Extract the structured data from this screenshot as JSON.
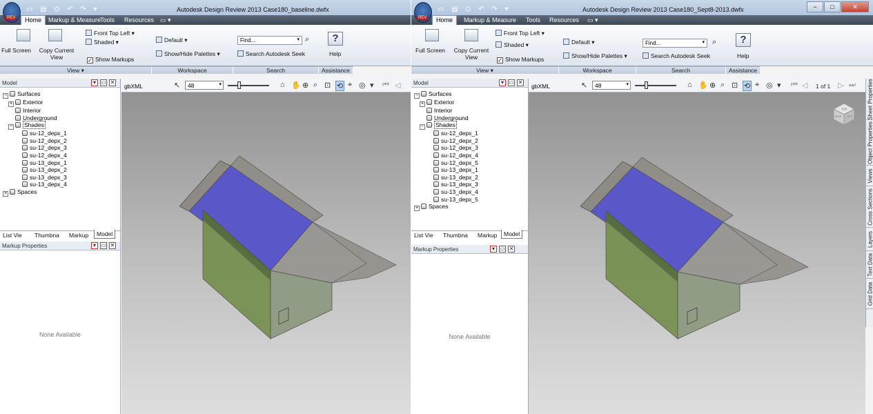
{
  "colors": {
    "ribbon_dark": "#4a5566",
    "canvas_top": "#929292",
    "canvas_bottom": "#dedede",
    "roof_blue": "#5050c8",
    "wall_green": "#789848"
  },
  "windows": [
    {
      "title": "Autodesk Design Review 2013    Case180_baseline.dwfx",
      "app_badge": "REV",
      "ribbon_tabs": [
        "Home",
        "Markup & Measure",
        "Tools",
        "Resources"
      ],
      "view_group": {
        "full_screen": "Full Screen",
        "copy_current_view": "Copy Current View",
        "front_top_left": "Front Top Left",
        "shaded": "Shaded",
        "show_markups": "Show Markups",
        "label": "View"
      },
      "workspace_group": {
        "default": "Default",
        "show_hide_palettes": "Show/Hide Palettes",
        "label": "Workspace"
      },
      "search_group": {
        "find_placeholder": "Find...",
        "seek": "Search Autodesk Seek",
        "label": "Search"
      },
      "assistance_group": {
        "help": "Help",
        "label": "Assistance"
      },
      "model_panel_title": "Model",
      "tree": {
        "surfaces": "Surfaces",
        "exterior": "Exterior",
        "interior": "Interior",
        "underground": "Underground",
        "shades": "Shades",
        "shade_items": [
          "su-12_depx_1",
          "su-12_depx_2",
          "su-12_depx_3",
          "su-12_depx_4",
          "su-13_depx_1",
          "su-13_depx_2",
          "su-13_depx_3",
          "su-13_depx_4"
        ],
        "spaces": "Spaces"
      },
      "panel_tabs": [
        "List Vie",
        "Thumbna",
        "Markup",
        "Model"
      ],
      "markup_properties": "Markup Properties",
      "none_available": "None Available",
      "sheet_name": "gbXML",
      "zoom": "48"
    },
    {
      "title": "Autodesk Design Review 2013    Case180_Sept8-2013.dwfx",
      "app_badge": "REV",
      "ribbon_tabs": [
        "Home",
        "Markup & Measure",
        "Tools",
        "Resources"
      ],
      "view_group": {
        "full_screen": "Full Screen",
        "copy_current_view": "Copy Current View",
        "front_top_left": "Front Top Left",
        "shaded": "Shaded",
        "show_markups": "Show Markups",
        "label": "View"
      },
      "workspace_group": {
        "default": "Default",
        "show_hide_palettes": "Show/Hide Palettes",
        "label": "Workspace"
      },
      "search_group": {
        "find_placeholder": "Find...",
        "seek": "Search Autodesk Seek",
        "label": "Search"
      },
      "assistance_group": {
        "help": "Help",
        "label": "Assistance"
      },
      "model_panel_title": "Model",
      "tree": {
        "surfaces": "Surfaces",
        "exterior": "Exterior",
        "interior": "Interior",
        "underground": "Underground",
        "shades": "Shades",
        "shade_items": [
          "su-12_depx_1",
          "su-12_depx_2",
          "su-12_depx_3",
          "su-12_depx_4",
          "su-12_depx_5",
          "su-13_depx_1",
          "su-13_depx_2",
          "su-13_depx_3",
          "su-13_depx_4",
          "su-13_depx_5"
        ],
        "spaces": "Spaces"
      },
      "panel_tabs": [
        "List Vie",
        "Thumbna",
        "Markup",
        "Model"
      ],
      "markup_properties": "Markup Properties",
      "none_available": "None Available",
      "sheet_name": "gbXML",
      "zoom": "48",
      "page_indicator": "1 of 1",
      "navcube_faces": [
        "TOP",
        "BACK",
        "LEFT"
      ],
      "side_tabs": [
        "Sheet Properties",
        "Object Properties",
        "Views",
        "Cross Sections",
        "Layers",
        "Text Data",
        "Grid Data"
      ]
    }
  ]
}
